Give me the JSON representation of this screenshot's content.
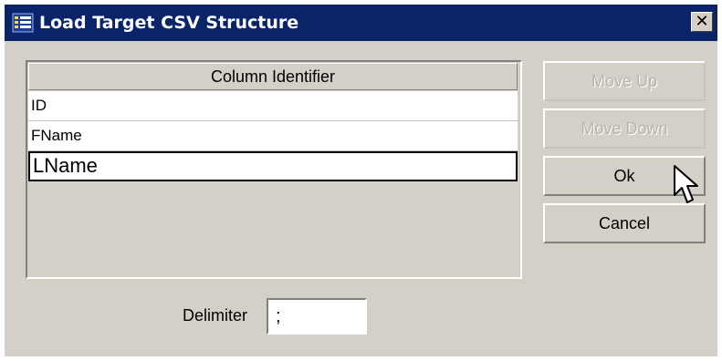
{
  "window": {
    "title": "Load Target CSV Structure",
    "close_glyph": "✕",
    "titlebar_color": "#0a246a",
    "face_color": "#d4d0c8"
  },
  "table": {
    "header": "Column Identifier",
    "rows": [
      "ID",
      "FName",
      "LName"
    ]
  },
  "buttons": {
    "move_up": "Move Up",
    "move_down": "Move Down",
    "ok": "Ok",
    "cancel": "Cancel"
  },
  "delimiter": {
    "label": "Delimiter",
    "value": ";"
  },
  "icons": {
    "window": "app-window-icon",
    "close": "close-icon",
    "cursor": "mouse-pointer-icon"
  }
}
